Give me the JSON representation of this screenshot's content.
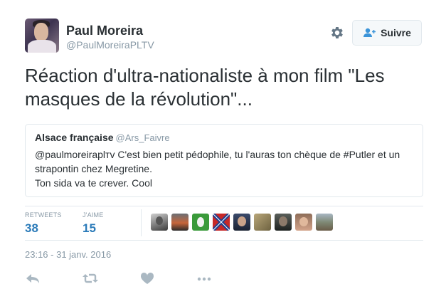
{
  "author": {
    "name": "Paul Moreira",
    "handle": "@PaulMoreiraPLTV"
  },
  "follow_button": {
    "label": "Suivre"
  },
  "tweet": {
    "text": "Réaction d'ultra-nationaliste à mon film \"Les masques de la révolution\"..."
  },
  "quoted_tweet": {
    "name": "Alsace française",
    "handle": "@Ars_Faivre",
    "line1": "@paulmoreiraplтv C'est bien petit pédophile, tu l'auras ton chèque de #Putler et un",
    "line2": "strapontin chez Megretine.",
    "line3": "Ton sida va te crever. Cool"
  },
  "stats": {
    "retweets_label": "RETWEETS",
    "retweets_value": "38",
    "likes_label": "J'AIME",
    "likes_value": "15"
  },
  "likers": [
    {
      "icon": "user-avatar"
    },
    {
      "icon": "user-avatar"
    },
    {
      "icon": "user-avatar"
    },
    {
      "icon": "user-avatar"
    },
    {
      "icon": "user-avatar"
    },
    {
      "icon": "user-avatar"
    },
    {
      "icon": "user-avatar"
    },
    {
      "icon": "user-avatar"
    },
    {
      "icon": "user-avatar"
    }
  ],
  "timestamp": "23:16 - 31 janv. 2016",
  "actions": [
    {
      "icon": "reply-icon"
    },
    {
      "icon": "retweet-icon"
    },
    {
      "icon": "heart-icon"
    },
    {
      "icon": "more-icon"
    }
  ],
  "colors": {
    "text": "#292f33",
    "muted": "#8899a6",
    "link": "#2b7bb9",
    "border": "#e1e8ed"
  }
}
